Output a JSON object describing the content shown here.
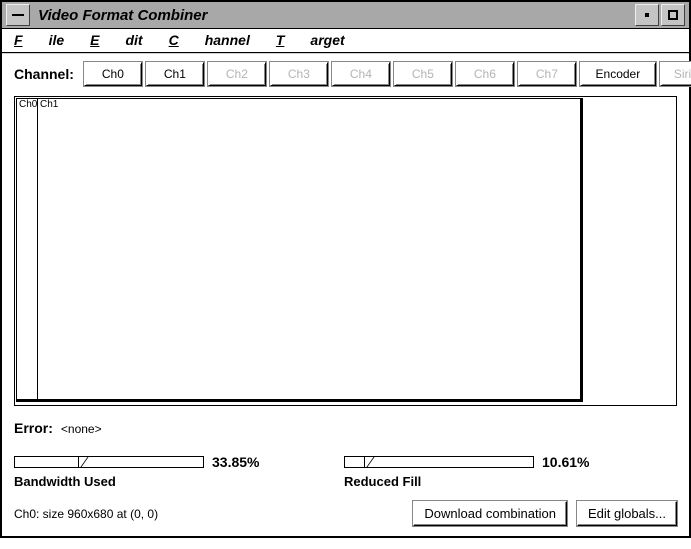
{
  "window": {
    "title": "Video Format Combiner"
  },
  "menus": {
    "file": "File",
    "edit": "Edit",
    "channel": "Channel",
    "target": "Target"
  },
  "channel": {
    "label": "Channel:",
    "buttons": [
      {
        "label": "Ch0",
        "enabled": true
      },
      {
        "label": "Ch1",
        "enabled": true
      },
      {
        "label": "Ch2",
        "enabled": false
      },
      {
        "label": "Ch3",
        "enabled": false
      },
      {
        "label": "Ch4",
        "enabled": false
      },
      {
        "label": "Ch5",
        "enabled": false
      },
      {
        "label": "Ch6",
        "enabled": false
      },
      {
        "label": "Ch7",
        "enabled": false
      },
      {
        "label": "Encoder",
        "enabled": true
      },
      {
        "label": "Sirius",
        "enabled": false
      }
    ]
  },
  "canvas": {
    "ch0_label": "Ch0",
    "ch1_label": "Ch1"
  },
  "error": {
    "label": "Error:",
    "value": "<none>"
  },
  "meters": {
    "bandwidth": {
      "percent_text": "33.85%",
      "percent": 33.85,
      "caption": "Bandwidth Used"
    },
    "fill": {
      "percent_text": "10.61%",
      "percent": 10.61,
      "caption": "Reduced Fill"
    }
  },
  "status": "Ch0: size 960x680 at (0, 0)",
  "actions": {
    "download": "Download combination",
    "globals": "Edit globals..."
  }
}
